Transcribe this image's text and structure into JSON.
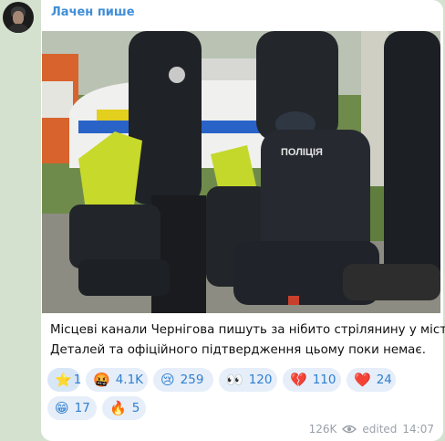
{
  "channel": {
    "name": "Лачен пише"
  },
  "message": {
    "line1": "Місцеві канали Чернігова пишуть за нібито стрілянину у місті.",
    "line2": "Деталей та офіційного підтвердження цьому поки немає."
  },
  "photo": {
    "description": "police officers restraining a person on the ground",
    "vest_text_1": "ПОЛІЦІЯ",
    "vest_text_2": "ПОЛІЦ"
  },
  "reactions": [
    {
      "emoji": "⭐",
      "icon": "star-icon",
      "count": "1"
    },
    {
      "emoji": "🤬",
      "icon": "angry-face-icon",
      "count": "4.1K"
    },
    {
      "emoji": "😢",
      "icon": "crying-face-icon",
      "count": "259"
    },
    {
      "emoji": "👀",
      "icon": "eyes-icon",
      "count": "120"
    },
    {
      "emoji": "💔",
      "icon": "broken-heart-icon",
      "count": "110"
    },
    {
      "emoji": "❤️",
      "icon": "heart-icon",
      "count": "24"
    },
    {
      "emoji": "😁",
      "icon": "grin-face-icon",
      "count": "17"
    },
    {
      "emoji": "🔥",
      "icon": "fire-icon",
      "count": "5"
    }
  ],
  "meta": {
    "views": "126K",
    "edited_label": "edited",
    "time": "14:07"
  },
  "colors": {
    "background": "#d5e1cf",
    "bubble": "#ffffff",
    "accent": "#3f8ed8",
    "reaction_bg": "#e5eef9",
    "meta_text": "#9aa1a9"
  }
}
